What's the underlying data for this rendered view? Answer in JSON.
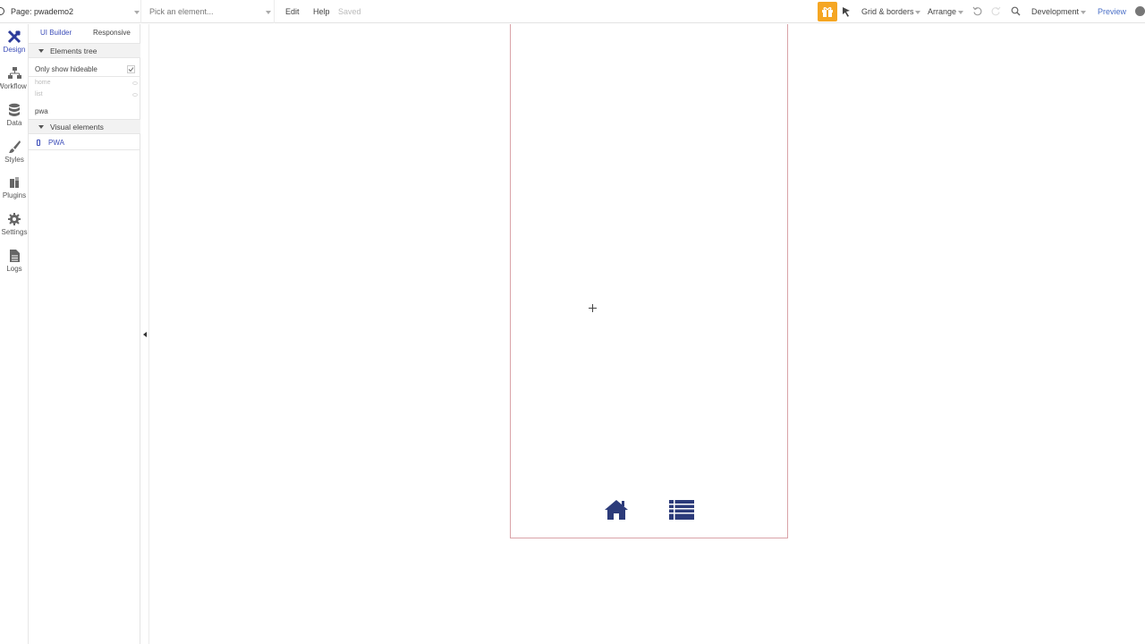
{
  "topbar": {
    "page_label": "Page: pwademo2",
    "element_picker_placeholder": "Pick an element...",
    "edit": "Edit",
    "help": "Help",
    "saved": "Saved",
    "grid_borders": "Grid & borders",
    "arrange": "Arrange",
    "environment": "Development",
    "preview": "Preview",
    "accent_color": "#f5a623"
  },
  "rail": {
    "items": [
      {
        "label": "Design",
        "icon": "design-icon",
        "active": true
      },
      {
        "label": "Workflow",
        "icon": "workflow-icon"
      },
      {
        "label": "Data",
        "icon": "data-icon"
      },
      {
        "label": "Styles",
        "icon": "styles-icon"
      },
      {
        "label": "Plugins",
        "icon": "plugins-icon"
      },
      {
        "label": "Settings",
        "icon": "settings-icon"
      },
      {
        "label": "Logs",
        "icon": "logs-icon"
      }
    ]
  },
  "panel": {
    "tab_ui_builder": "UI Builder",
    "tab_responsive": "Responsive",
    "elements_tree": "Elements tree",
    "only_show_hideable": "Only show hideable",
    "only_show_hideable_checked": true,
    "tree_items": [
      "home",
      "list"
    ],
    "pwa_item": "pwa",
    "visual_elements": "Visual elements",
    "visual_element_item": "PWA"
  },
  "canvas": {
    "nav_icons": [
      "home-icon",
      "list-icon"
    ],
    "nav_color": "#2c3b7a"
  }
}
